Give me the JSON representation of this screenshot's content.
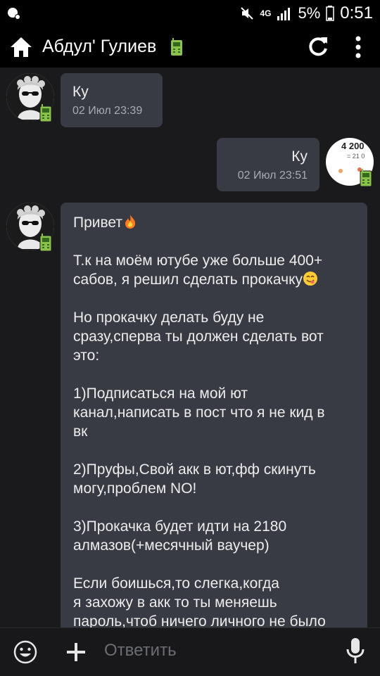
{
  "status_bar": {
    "network": "4G",
    "battery": "5%",
    "time": "0:51"
  },
  "header": {
    "title": "Абдул' Гулиев",
    "icons": [
      "home-icon",
      "phone-icon",
      "refresh-icon",
      "more-vert-icon"
    ]
  },
  "messages": [
    {
      "direction": "incoming",
      "text": "Ку",
      "time": "02 Июл 23:39"
    },
    {
      "direction": "outgoing",
      "text": "Ку",
      "time": "02 Июл 23:51",
      "avatar_text": "4 200",
      "avatar_sub": "= 21 0"
    },
    {
      "direction": "incoming",
      "lines": [
        "Привет",
        "",
        "Т.к на моём ютубе уже больше 400+",
        "сабов, я решил сделать прокачку",
        "",
        "Но прокачку делать буду не",
        "сразу,сперва ты должен сделать вот",
        "это:",
        "",
        "1)Подписаться на мой ют",
        "канал,написать в пост что я не кид в",
        "вк",
        "",
        "2)Пруфы,Свой акк в ют,фф скинуть",
        "могу,проблем NO!",
        "",
        "3)Прокачка будет идти на 2180",
        "алмазов(+месячный ваучер)",
        "",
        "Если боишься,то слегка,когда",
        "я захожу в акк то ты меняешь",
        "пароль,чтоб ничего личного не было"
      ]
    }
  ],
  "composer": {
    "placeholder": "Ответить",
    "icons": [
      "emoji-icon",
      "plus-icon",
      "microphone-icon"
    ]
  },
  "colors": {
    "background": "#1a1a1d",
    "bubble": "#393b44",
    "toolbar": "#000000",
    "phone_badge": "#8bc34a"
  }
}
